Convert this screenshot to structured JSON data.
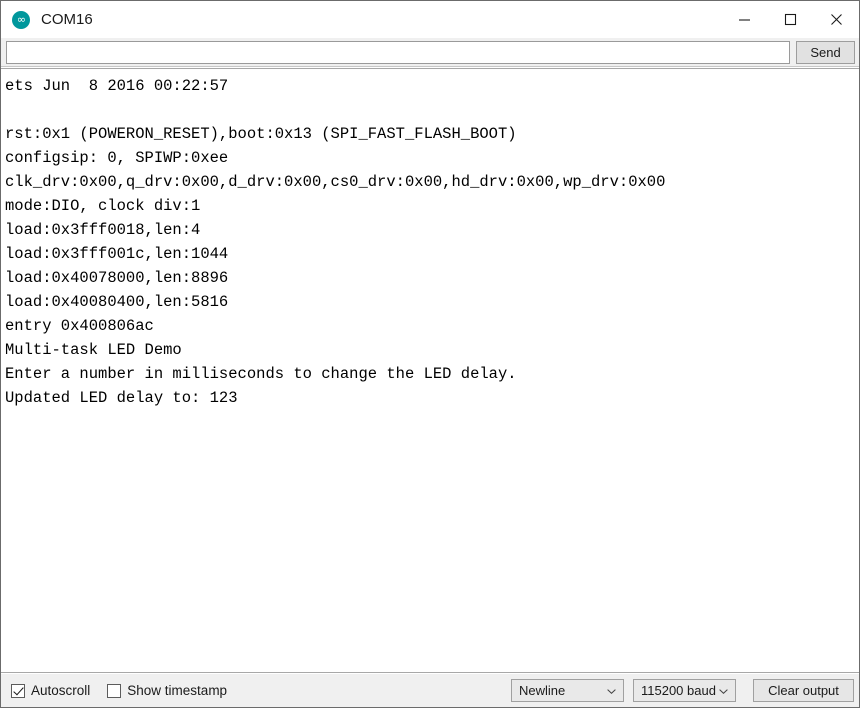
{
  "window": {
    "title": "COM16",
    "app_icon": "arduino-infinity-icon",
    "controls": {
      "minimize": "minimize-icon",
      "maximize": "maximize-icon",
      "close": "close-icon"
    }
  },
  "send_row": {
    "input_value": "",
    "input_placeholder": "",
    "send_label": "Send"
  },
  "terminal": {
    "lines": [
      "ets Jun  8 2016 00:22:57",
      "",
      "rst:0x1 (POWERON_RESET),boot:0x13 (SPI_FAST_FLASH_BOOT)",
      "configsip: 0, SPIWP:0xee",
      "clk_drv:0x00,q_drv:0x00,d_drv:0x00,cs0_drv:0x00,hd_drv:0x00,wp_drv:0x00",
      "mode:DIO, clock div:1",
      "load:0x3fff0018,len:4",
      "load:0x3fff001c,len:1044",
      "load:0x40078000,len:8896",
      "load:0x40080400,len:5816",
      "entry 0x400806ac",
      "Multi-task LED Demo",
      "Enter a number in milliseconds to change the LED delay.",
      "Updated LED delay to: 123"
    ]
  },
  "status_bar": {
    "autoscroll_label": "Autoscroll",
    "autoscroll_checked": true,
    "timestamp_label": "Show timestamp",
    "timestamp_checked": false,
    "line_ending_value": "Newline",
    "baud_value": "115200 baud",
    "clear_label": "Clear output"
  },
  "colors": {
    "accent": "#00979c",
    "titlebar_bg": "#ffffff",
    "toolbar_bg": "#f0f0f0",
    "terminal_bg": "#ffffff",
    "text": "#000000"
  }
}
